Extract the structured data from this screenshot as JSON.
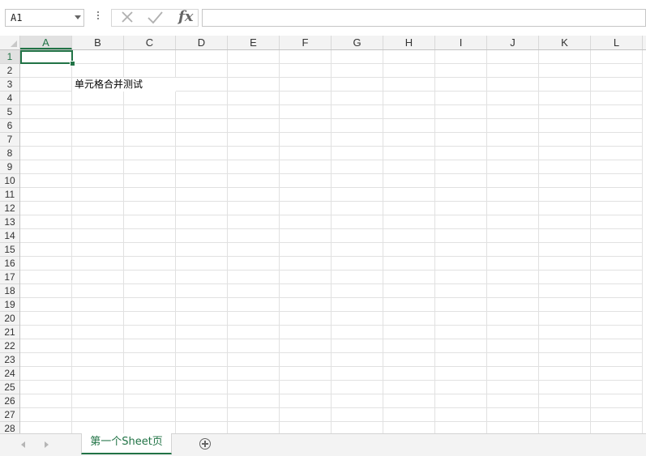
{
  "name_box": {
    "value": "A1"
  },
  "formula_bar": {
    "fx_label": "fx",
    "content": ""
  },
  "columns": [
    "A",
    "B",
    "C",
    "D",
    "E",
    "F",
    "G",
    "H",
    "I",
    "J",
    "K",
    "L"
  ],
  "rows": [
    "1",
    "2",
    "3",
    "4",
    "5",
    "6",
    "7",
    "8",
    "9",
    "10",
    "11",
    "12",
    "13",
    "14",
    "15",
    "16",
    "17",
    "18",
    "19",
    "20",
    "21",
    "22",
    "23",
    "24",
    "25",
    "26",
    "27",
    "28"
  ],
  "selected_cell": "A1",
  "merged_cell": {
    "range": "B3:C3",
    "text": "单元格合并测试"
  },
  "sheet_tabs": [
    {
      "label": "第一个Sheet页",
      "active": true
    }
  ],
  "icons": {
    "cancel": "close-x-icon",
    "enter": "checkmark-icon",
    "add_sheet": "plus-circle-icon"
  },
  "colors": {
    "accent": "#217346"
  }
}
